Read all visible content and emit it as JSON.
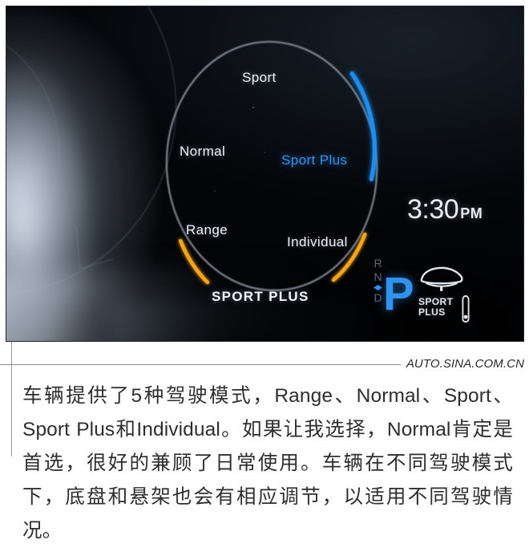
{
  "photo": {
    "alt_name": "car-instrument-cluster-drive-mode-dial",
    "dial": {
      "selected_mode": "Sport Plus",
      "bottom_label": "SPORT PLUS",
      "modes": [
        {
          "key": "sport",
          "label": "Sport",
          "state": "normal"
        },
        {
          "key": "normal",
          "label": "Normal",
          "state": "normal"
        },
        {
          "key": "sport_plus",
          "label": "Sport Plus",
          "state": "selected"
        },
        {
          "key": "range",
          "label": "Range",
          "state": "normal"
        },
        {
          "key": "individual",
          "label": "Individual",
          "state": "normal"
        }
      ],
      "colors": {
        "ring": "#8e99a6",
        "selected_arc": "#1f8ef1",
        "accent_arc": "#f5a519",
        "selected_text": "#2f93f0",
        "text": "#eef1f5"
      }
    },
    "clock": {
      "time": "3:30",
      "meridiem": "PM"
    },
    "gear": {
      "current": "P",
      "positions": [
        "R",
        "N",
        "D"
      ],
      "color": "#2f93f0"
    },
    "suspension": {
      "icon_name": "car-side-suspension-icon",
      "line1": "SPORT",
      "line2": "PLUS"
    }
  },
  "caption": {
    "watermark": "AUTO.SINA.COM.CN",
    "text": "车辆提供了5种驾驶模式，Range、Normal、Sport、Sport Plus和Individual。如果让我选择，Normal肯定是首选，很好的兼顾了日常使用。车辆在不同驾驶模式下，底盘和悬架也会有相应调节，以适用不同驾驶情况。"
  }
}
